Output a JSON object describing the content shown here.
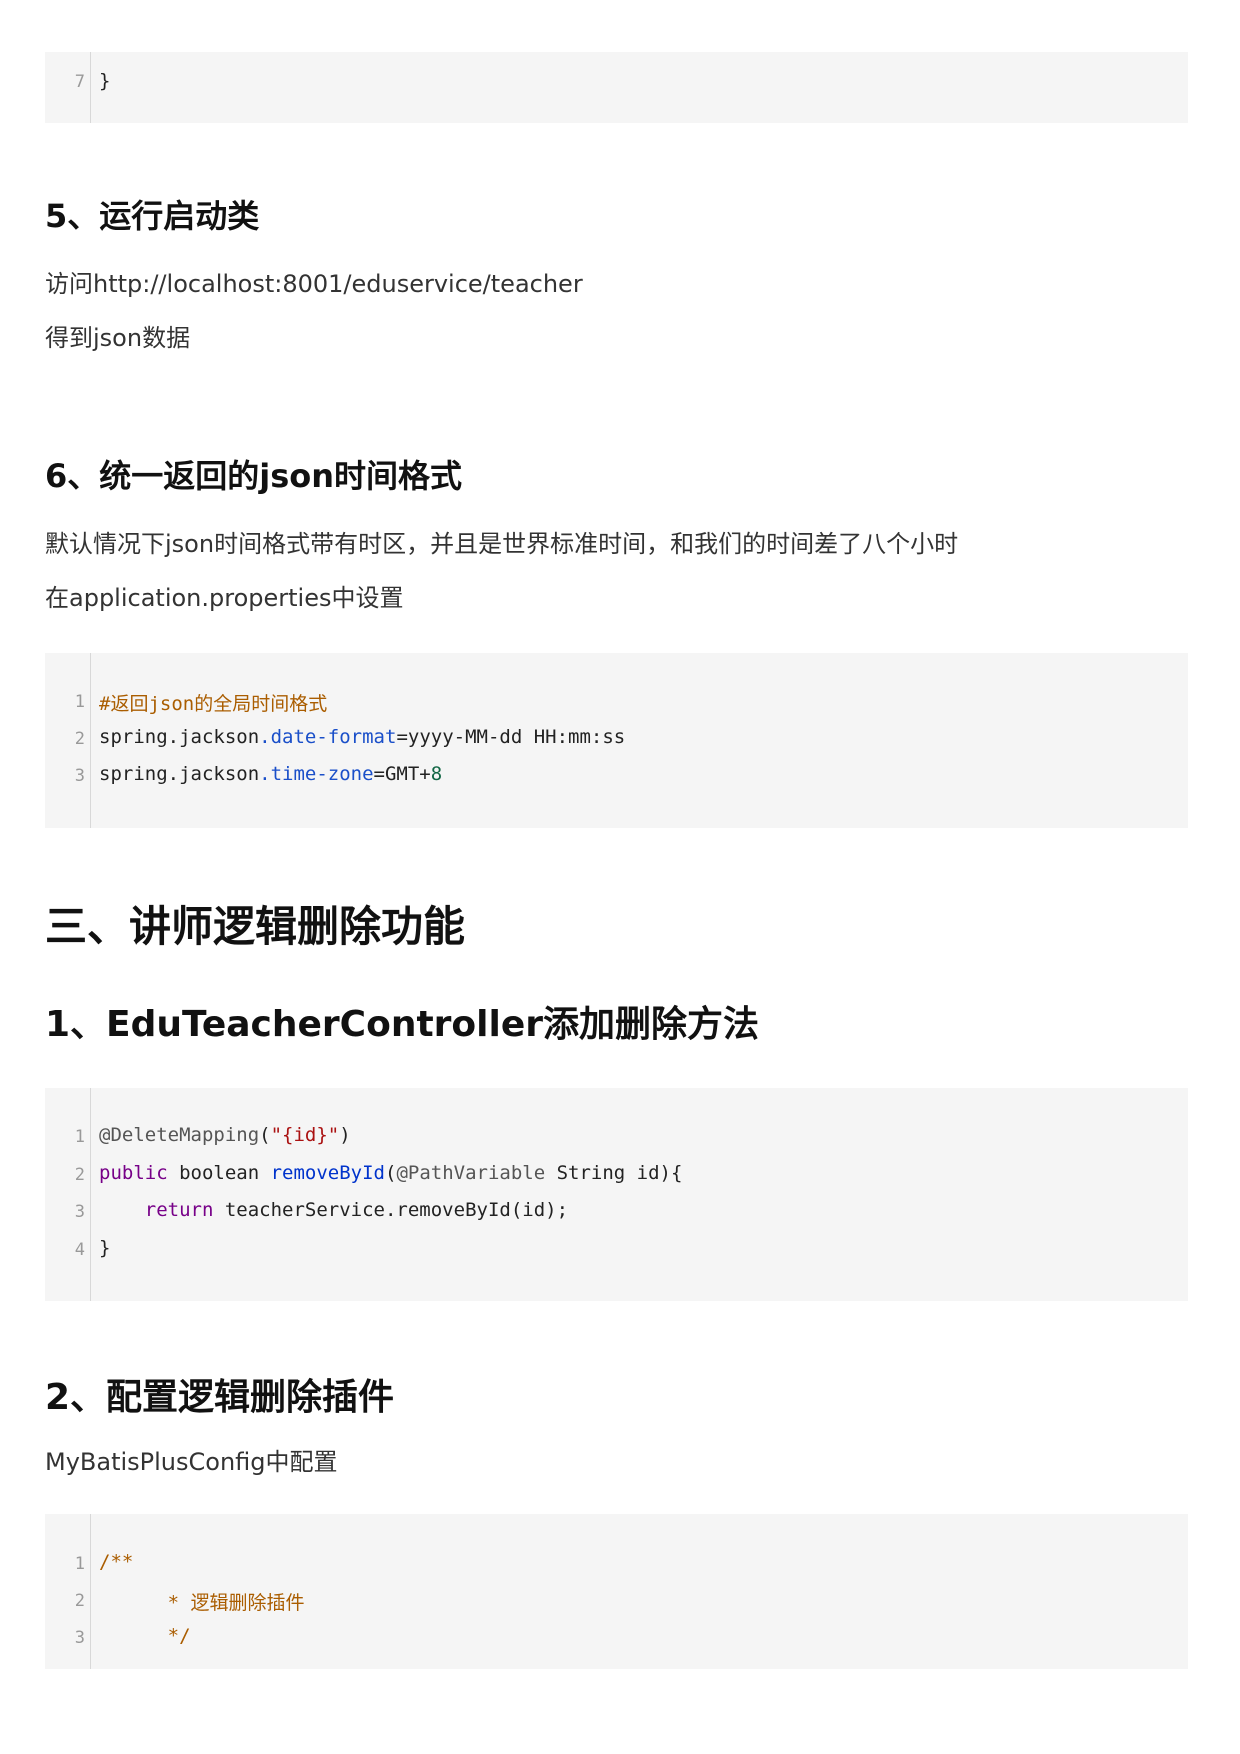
{
  "block_top": {
    "lines": [
      {
        "no": "7",
        "text": "}"
      }
    ]
  },
  "section5": {
    "heading": "5、运行启动类",
    "p1": "访问http://localhost:8001/eduservice/teacher",
    "p2": "得到json数据"
  },
  "section6": {
    "heading": "6、统一返回的json时间格式",
    "p1": "默认情况下json时间格式带有时区，并且是世界标准时间，和我们的时间差了八个小时",
    "p2": "在application.properties中设置",
    "code": {
      "line_numbers": [
        "1",
        "2",
        "3"
      ],
      "l1_comment": "#返回json的全局时间格式",
      "l2_a": "spring.jackson",
      "l2_b": ".date-format",
      "l2_c": "=yyyy-MM-dd HH:mm:ss",
      "l3_a": "spring.jackson",
      "l3_b": ".time-zone",
      "l3_c": "=GMT+",
      "l3_d": "8"
    }
  },
  "part3": {
    "heading": "三、讲师逻辑删除功能"
  },
  "sub1": {
    "heading": "1、EduTeacherController添加删除方法",
    "code": {
      "line_numbers": [
        "1",
        "2",
        "3",
        "4"
      ],
      "l1_a": "@DeleteMapping",
      "l1_b": "(",
      "l1_c": "\"{id}\"",
      "l1_d": ")",
      "l2_a": "public",
      "l2_b": " boolean ",
      "l2_c": "removeById",
      "l2_d": "(",
      "l2_e": "@PathVariable",
      "l2_f": " String id){",
      "l3_indent": "    ",
      "l3_a": "return",
      "l3_b": " teacherService.removeById(id);",
      "l4": "}"
    }
  },
  "sub2": {
    "heading": "2、配置逻辑删除插件",
    "p1": "MyBatisPlusConfig中配置",
    "code": {
      "line_numbers": [
        "1",
        "2",
        "3"
      ],
      "l1": "/**",
      "l2": "      * 逻辑删除插件",
      "l3": "      */"
    }
  }
}
